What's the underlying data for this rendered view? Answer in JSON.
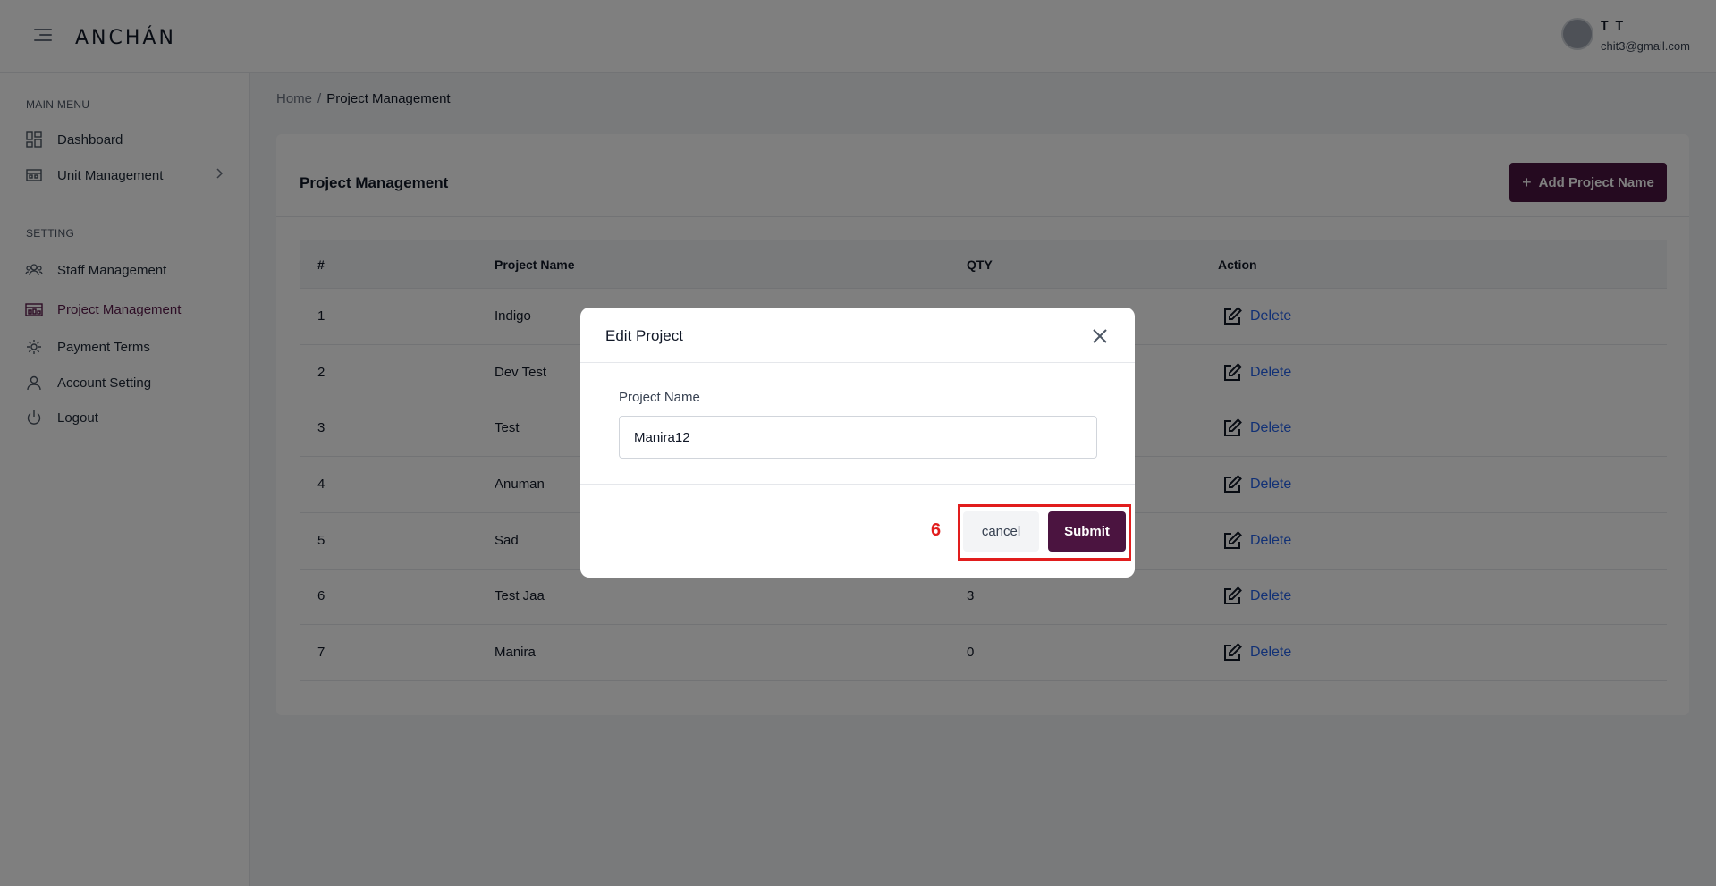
{
  "header": {
    "logo": "ANCHÁN",
    "user_name": "T T",
    "user_email": "chit3@gmail.com"
  },
  "sidebar": {
    "main_menu_title": "MAIN MENU",
    "main_items": [
      {
        "label": "Dashboard",
        "icon": "dashboard-icon"
      },
      {
        "label": "Unit Management",
        "icon": "unit-icon"
      }
    ],
    "setting_title": "SETTING",
    "setting_items": [
      {
        "label": "Staff Management",
        "icon": "staff-icon"
      },
      {
        "label": "Project Management",
        "icon": "project-icon",
        "active": true
      },
      {
        "label": "Payment Terms",
        "icon": "gear-icon"
      },
      {
        "label": "Account Setting",
        "icon": "user-icon"
      },
      {
        "label": "Logout",
        "icon": "power-icon"
      }
    ],
    "active_color": "#5a1a4a"
  },
  "breadcrumb": {
    "home": "Home",
    "separator": "/",
    "current": "Project Management"
  },
  "card": {
    "title": "Project Management",
    "add_button": "Add Project Name",
    "add_icon": "+"
  },
  "table": {
    "headers": [
      "#",
      "Project Name",
      "QTY",
      "Action"
    ],
    "rows": [
      {
        "num": "1",
        "name": "Indigo",
        "qty": "",
        "action": "Delete"
      },
      {
        "num": "2",
        "name": "Dev Test",
        "qty": "",
        "action": "Delete"
      },
      {
        "num": "3",
        "name": "Test",
        "qty": "",
        "action": "Delete"
      },
      {
        "num": "4",
        "name": "Anuman",
        "qty": "",
        "action": "Delete"
      },
      {
        "num": "5",
        "name": "Sad",
        "qty": "",
        "action": "Delete"
      },
      {
        "num": "6",
        "name": "Test Jaa",
        "qty": "3",
        "action": "Delete"
      },
      {
        "num": "7",
        "name": "Manira",
        "qty": "0",
        "action": "Delete"
      }
    ]
  },
  "modal": {
    "title": "Edit Project",
    "field_label": "Project Name",
    "field_value": "Manira12",
    "cancel": "cancel",
    "submit": "Submit",
    "step_number": "6"
  },
  "colors": {
    "brand": "#4b1440",
    "link": "#2563eb",
    "annotation": "#e11d1d"
  }
}
